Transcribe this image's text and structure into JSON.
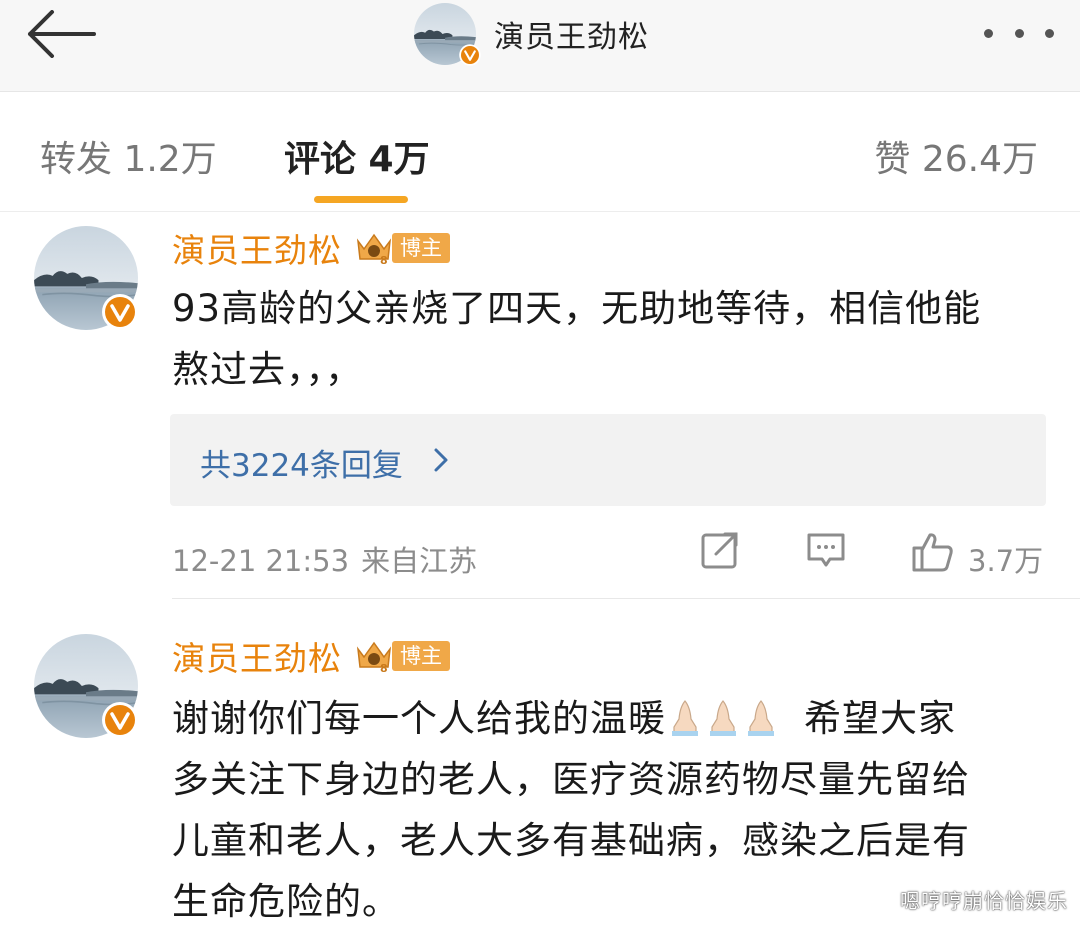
{
  "nav": {
    "title": "演员王劲松",
    "back_icon": "back-arrow-icon",
    "more_icon": "more-dots-icon"
  },
  "tabs": {
    "repost": "转发 1.2万",
    "comment": "评论 4万",
    "like": "赞 26.4万",
    "accent": "#f5a623"
  },
  "comments": [
    {
      "author": "演员王劲松",
      "tag": "博主",
      "content_lines": [
        "93高龄的父亲烧了四天，无助地等待，相信他能",
        "熬过去，，，"
      ],
      "replies": "共3224条回复",
      "time": "12-21 21:53",
      "location": "来自江苏",
      "likes": "3.7万"
    },
    {
      "author": "演员王劲松",
      "tag": "博主",
      "content_line1_a": "谢谢你们每一个人给我的温暖",
      "content_line1_b": "希望大家",
      "content_lines": [
        "多关注下身边的老人，医疗资源药物尽量先留给",
        "儿童和老人，老人大多有基础病，感染之后是有",
        "生命危险的。"
      ]
    }
  ],
  "watermark": "嗯哼哼崩恰恰娱乐",
  "colors": {
    "author": "#e8830c",
    "link": "#3e6fa8",
    "meta": "#8c8c8c",
    "verified": "#e8830c"
  }
}
